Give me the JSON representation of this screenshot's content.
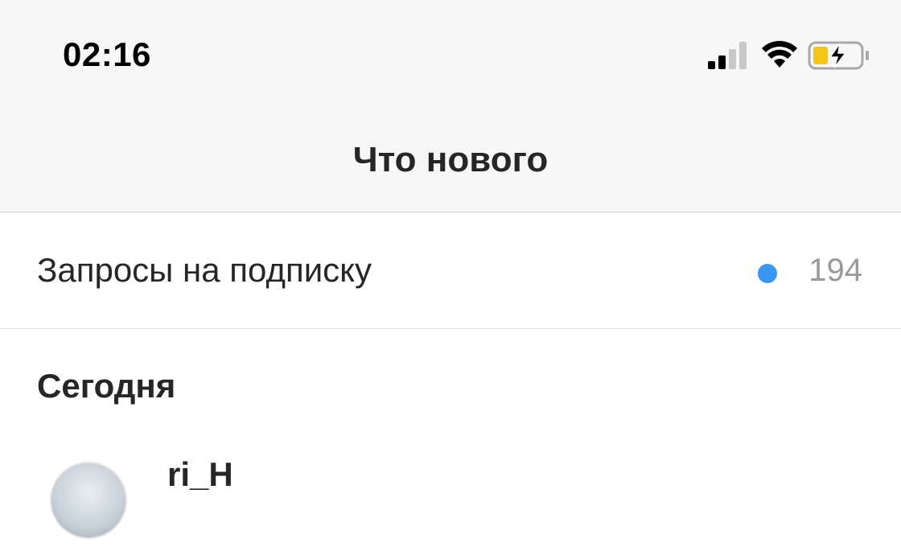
{
  "status_bar": {
    "time": "02:16",
    "icons": [
      "cellular-signal-icon",
      "wifi-icon",
      "battery-charging-icon"
    ],
    "battery_color": "#f5c518"
  },
  "header": {
    "title": "Что нового"
  },
  "follow_requests": {
    "label": "Запросы на подписку",
    "count": "194",
    "dot_color": "#3897f0"
  },
  "sections": [
    {
      "title": "Сегодня",
      "items": [
        {
          "username": "ri_H"
        }
      ]
    }
  ]
}
